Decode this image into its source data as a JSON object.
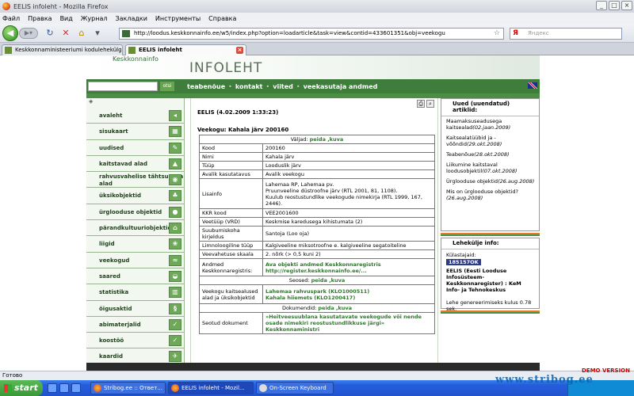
{
  "browser": {
    "window_title": "EELIS infoleht - Mozilla Firefox",
    "menu": [
      "Файл",
      "Правка",
      "Вид",
      "Журнал",
      "Закладки",
      "Инструменты",
      "Справка"
    ],
    "url": "http://loodus.keskkonnainfo.ee/w5/index.php?option=loadarticle&task=view&contid=433601351&obj=veekogu",
    "search_placeholder": "Яндекс",
    "search_logo": "Я",
    "tabs": [
      {
        "label": "Keskkonnaministeeriumi kodulehekülg"
      },
      {
        "label": "EELIS infoleht"
      }
    ],
    "status": "Готово"
  },
  "site": {
    "logo_small": "Keskkonnainfo",
    "logo_big": "INFOLEHT",
    "search_go": "otsi",
    "nav": [
      "teabenõue",
      "kontakt",
      "viited",
      "veekasutaja andmed"
    ],
    "nav_sep": "•"
  },
  "sidebar": {
    "items": [
      {
        "label": "avaleht"
      },
      {
        "label": "sisukaart"
      },
      {
        "label": "uudised"
      },
      {
        "label": "kaitstavad alad"
      },
      {
        "label": "rahvusvahelise tähtsusega alad"
      },
      {
        "label": "üksikobjektid"
      },
      {
        "label": "ürglooduse objektid"
      },
      {
        "label": "pärandkultuuriobjektid"
      },
      {
        "label": "liigid"
      },
      {
        "label": "veekogud"
      },
      {
        "label": "saared"
      },
      {
        "label": "statistika"
      },
      {
        "label": "õigusaktid"
      },
      {
        "label": "abimaterjalid"
      },
      {
        "label": "koostöö"
      },
      {
        "label": "kaardid"
      }
    ]
  },
  "main": {
    "heading": "EELIS (4.02.2009 1:33:23)",
    "subheading": "Veekogu: Kahala järv 200160",
    "fields_header_prefix": "Väljad: ",
    "fields_header_links": "peida ,kuva",
    "rows": [
      {
        "key": "Kood",
        "value": "200160"
      },
      {
        "key": "Nimi",
        "value": "Kahala järv"
      },
      {
        "key": "Tüüp",
        "value": "Looduslik järv"
      },
      {
        "key": "Avalik kasutatavus",
        "value": "Avalik veekogu"
      },
      {
        "key": "Lisainfo",
        "value": "Lahemaa RP, Lahemaa pv.\nPruunveeline düstroofne järv (RTL 2001, 81, 1108).\nKuulub reostustundlike veekogude nimekirja (RTL 1999, 167, 2446)."
      },
      {
        "key": "KKR kood",
        "value": "VEE2001600"
      },
      {
        "key": "Veetüüp (VRD)",
        "value": "Keskmise karedusega kihistumata (2)"
      },
      {
        "key": "Suubumiskoha kirjeldus",
        "value": "Santoja (Loo oja)"
      },
      {
        "key": "Limnoloogiline tüüp",
        "value": "Kalgiveeline mikso­troofne e. kalgiveeline segatoiteline"
      },
      {
        "key": "Veevahetuse skaala",
        "value": "2. nõrk (> 0,5 kuni 2)"
      },
      {
        "key": "Andmed Keskkonnaregistris:",
        "value": "Ava objekti andmed Keskkonnaregistris\nhttp://register.keskkonnainfo.ee/..."
      }
    ],
    "seosed_prefix": "Seosed: ",
    "seosed_links": "peida ,kuva",
    "protected_key": "Veekogu kaitsealused alad ja üksikobjektid",
    "protected_values": [
      "Lahemaa rahvuspark (KLO1000511)",
      "Kahala hiiemets (KLO1200417)"
    ],
    "docs_prefix": "Dokumendid: ",
    "docs_links": "peida ,kuva",
    "doc_key": "Seotud dokument",
    "doc_value": "»Heitveesuublana kasutatavate veekogude või nende osade nimekiri reostustundlikkuse järgi» Keskkonnaministri"
  },
  "right": {
    "news_title": "Uued (uuendatud) artiklid:",
    "news": [
      {
        "text": "Maamaksuseadusega kaitsealad",
        "date": "(02.jaan.2009)"
      },
      {
        "text": "Kaitsealatüübid ja -võõndid",
        "date": "(29.okt.2008)"
      },
      {
        "text": "Teabenõue",
        "date": "(28.okt.2008)"
      },
      {
        "text": "Liikumine kaitstaval loodusobjektil",
        "date": "(07.okt.2008)"
      },
      {
        "text": "Ürglooduse objektid",
        "date": "(26.aug.2008)"
      },
      {
        "text": "Mis on ürglooduse objektid?",
        "date": "(26.aug.2008)"
      }
    ],
    "info_title": "Lehekülje info:",
    "visitors_label": "Külastajaid:",
    "visitors_count": "185157",
    "visitors_ok": "OK",
    "owner": "EELIS (Eesti Looduse Infosüsteem- Keskkonnaregister) : KeM Info- ja Tehnokeskus",
    "gen_time": "Lehe genereerimiseks kulus 0.78 sek."
  },
  "taskbar": {
    "start": "start",
    "tasks": [
      {
        "label": "Stribog.ee :: Ответ..."
      },
      {
        "label": "EELIS infoleht - Mozil..."
      },
      {
        "label": "On-Screen Keyboard"
      }
    ],
    "watermark": "www.stribog.ee",
    "demo": "DEMO VERSION"
  }
}
